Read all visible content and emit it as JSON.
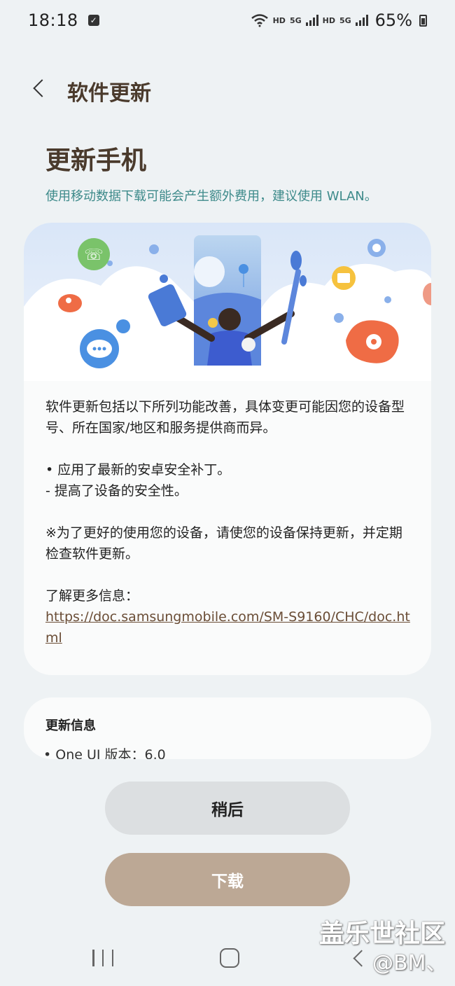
{
  "status_bar": {
    "time": "18:18",
    "network_labels": [
      "HD",
      "5G",
      "HD",
      "5G"
    ],
    "battery": "65%"
  },
  "header": {
    "title": "软件更新"
  },
  "main": {
    "heading": "更新手机",
    "data_note": "使用移动数据下载可能会产生额外费用，建议使用 WLAN。",
    "notes": {
      "intro": "软件更新包括以下所列功能改善，具体变更可能因您的设备型号、所在国家/地区和服务提供商而异。",
      "bullet": "• 应用了最新的安卓安全补丁。",
      "sub_bullet": " - 提高了设备的安全性。",
      "advice": "※为了更好的使用您的设备，请使您的设备保持更新，并定期检查软件更新。",
      "more_info_label": "了解更多信息：",
      "more_info_link": "https://doc.samsungmobile.com/SM-S9160/CHC/doc.html"
    },
    "update_info": {
      "title": "更新信息",
      "version_line": "• One UI 版本：6.0"
    }
  },
  "actions": {
    "later_label": "稍后",
    "download_label": "下载"
  },
  "overlay": {
    "watermark": "盖乐世社区",
    "user_tag": "@BM、"
  },
  "colors": {
    "background": "#eef2f4",
    "heading": "#4a3a2c",
    "note": "#3d8a8a",
    "download_button": "#bca895",
    "later_button": "#dcdfe1"
  },
  "icons": [
    "check-notification-icon",
    "wifi-icon",
    "signal-icon",
    "battery-icon",
    "back-icon",
    "phone-icon",
    "chat-icon",
    "settings-icon",
    "folder-icon",
    "flower-icon",
    "person-icon"
  ]
}
